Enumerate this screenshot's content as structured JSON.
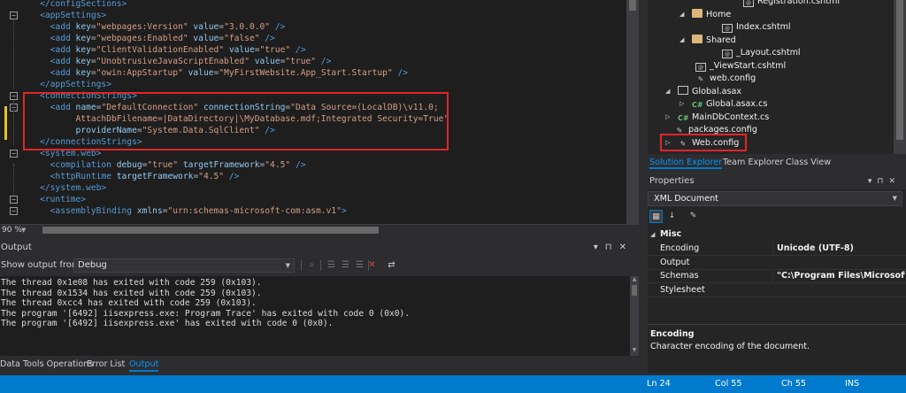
{
  "editor": {
    "lines": [
      [
        {
          "t": "tag",
          "s": "    </configSections>"
        }
      ],
      [
        {
          "t": "tag",
          "s": "    <appSettings>"
        }
      ],
      [
        {
          "t": "tag",
          "s": "      <add "
        },
        {
          "t": "attr",
          "s": "key"
        },
        {
          "t": "plain",
          "s": "="
        },
        {
          "t": "val",
          "s": "\"webpages:Version\""
        },
        {
          "t": "attr",
          "s": " value"
        },
        {
          "t": "plain",
          "s": "="
        },
        {
          "t": "val",
          "s": "\"3.0.0.0\""
        },
        {
          "t": "tag",
          "s": " />"
        }
      ],
      [
        {
          "t": "tag",
          "s": "      <add "
        },
        {
          "t": "attr",
          "s": "key"
        },
        {
          "t": "plain",
          "s": "="
        },
        {
          "t": "val",
          "s": "\"webpages:Enabled\""
        },
        {
          "t": "attr",
          "s": " value"
        },
        {
          "t": "plain",
          "s": "="
        },
        {
          "t": "val",
          "s": "\"false\""
        },
        {
          "t": "tag",
          "s": " />"
        }
      ],
      [
        {
          "t": "tag",
          "s": "      <add "
        },
        {
          "t": "attr",
          "s": "key"
        },
        {
          "t": "plain",
          "s": "="
        },
        {
          "t": "val",
          "s": "\"ClientValidationEnabled\""
        },
        {
          "t": "attr",
          "s": " value"
        },
        {
          "t": "plain",
          "s": "="
        },
        {
          "t": "val",
          "s": "\"true\""
        },
        {
          "t": "tag",
          "s": " />"
        }
      ],
      [
        {
          "t": "tag",
          "s": "      <add "
        },
        {
          "t": "attr",
          "s": "key"
        },
        {
          "t": "plain",
          "s": "="
        },
        {
          "t": "val",
          "s": "\"UnobtrusiveJavaScriptEnabled\""
        },
        {
          "t": "attr",
          "s": " value"
        },
        {
          "t": "plain",
          "s": "="
        },
        {
          "t": "val",
          "s": "\"true\""
        },
        {
          "t": "tag",
          "s": " />"
        }
      ],
      [
        {
          "t": "tag",
          "s": "      <add "
        },
        {
          "t": "attr",
          "s": "key"
        },
        {
          "t": "plain",
          "s": "="
        },
        {
          "t": "val",
          "s": "\"owin:AppStartup\""
        },
        {
          "t": "attr",
          "s": " value"
        },
        {
          "t": "plain",
          "s": "="
        },
        {
          "t": "val",
          "s": "\"MyFirstWebsite.App_Start.Startup\""
        },
        {
          "t": "tag",
          "s": " />"
        }
      ],
      [
        {
          "t": "tag",
          "s": "    </appSettings>"
        }
      ],
      [
        {
          "t": "tag",
          "s": "    <connectionStrings>"
        }
      ],
      [
        {
          "t": "tag",
          "s": "      <add "
        },
        {
          "t": "attr",
          "s": "name"
        },
        {
          "t": "plain",
          "s": "="
        },
        {
          "t": "val",
          "s": "\"DefaultConnection\""
        },
        {
          "t": "attr",
          "s": " connectionString"
        },
        {
          "t": "plain",
          "s": "="
        },
        {
          "t": "val",
          "s": "\"Data Source=(LocalDB)\\v11.0;"
        }
      ],
      [
        {
          "t": "val",
          "s": "           AttachDbFilename=|DataDirectory|\\MyDatabase.mdf;Integrated Security=True\""
        }
      ],
      [
        {
          "t": "attr",
          "s": "           providerName"
        },
        {
          "t": "plain",
          "s": "="
        },
        {
          "t": "val",
          "s": "\"System.Data.SqlClient\""
        },
        {
          "t": "tag",
          "s": " />"
        }
      ],
      [
        {
          "t": "tag",
          "s": "    </connectionStrings>"
        }
      ],
      [
        {
          "t": "tag",
          "s": "    <system.web>"
        }
      ],
      [
        {
          "t": "tag",
          "s": "      <compilation "
        },
        {
          "t": "attr",
          "s": "debug"
        },
        {
          "t": "plain",
          "s": "="
        },
        {
          "t": "val",
          "s": "\"true\""
        },
        {
          "t": "attr",
          "s": " targetFramework"
        },
        {
          "t": "plain",
          "s": "="
        },
        {
          "t": "val",
          "s": "\"4.5\""
        },
        {
          "t": "tag",
          "s": " />"
        }
      ],
      [
        {
          "t": "tag",
          "s": "      <httpRuntime "
        },
        {
          "t": "attr",
          "s": "targetFramework"
        },
        {
          "t": "plain",
          "s": "="
        },
        {
          "t": "val",
          "s": "\"4.5\""
        },
        {
          "t": "tag",
          "s": " />"
        }
      ],
      [
        {
          "t": "tag",
          "s": "    </system.web>"
        }
      ],
      [
        {
          "t": "tag",
          "s": "    <runtime>"
        }
      ],
      [
        {
          "t": "tag",
          "s": "      <assemblyBinding "
        },
        {
          "t": "attr",
          "s": "xmlns"
        },
        {
          "t": "plain",
          "s": "="
        },
        {
          "t": "val",
          "s": "\"urn:schemas-microsoft-com:asm.v1\""
        },
        {
          "t": "tag",
          "s": ">"
        }
      ]
    ],
    "zoom": "90 %"
  },
  "output": {
    "title": "Output",
    "show_from_label": "Show output from:",
    "source": "Debug",
    "lines": [
      "The thread 0x1e08 has exited with code 259 (0x103).",
      "The thread 0x1534 has exited with code 259 (0x103).",
      "The thread 0xcc4 has exited with code 259 (0x103).",
      "The program '[6492] iisexpress.exe: Program Trace' has exited with code 0 (0x0).",
      "The program '[6492] iisexpress.exe' has exited with code 0 (0x0)."
    ]
  },
  "bottom_tabs": [
    "Data Tools Operations",
    "Error List",
    "Output"
  ],
  "solution_explorer": {
    "items": [
      {
        "label": "Registration.cshtml",
        "icon": "cshtml-file-icon"
      },
      {
        "label": "Home",
        "icon": "folder-icon"
      },
      {
        "label": "Index.cshtml",
        "icon": "cshtml-file-icon"
      },
      {
        "label": "Shared",
        "icon": "folder-icon"
      },
      {
        "label": "_Layout.cshtml",
        "icon": "cshtml-file-icon"
      },
      {
        "label": "_ViewStart.cshtml",
        "icon": "cshtml-file-icon"
      },
      {
        "label": "web.config",
        "icon": "config-file-icon"
      },
      {
        "label": "Global.asax",
        "icon": "asax-file-icon"
      },
      {
        "label": "Global.asax.cs",
        "icon": "cs-file-icon"
      },
      {
        "label": "MainDbContext.cs",
        "icon": "cs-file-icon"
      },
      {
        "label": "packages.config",
        "icon": "config-file-icon"
      },
      {
        "label": "Web.config",
        "icon": "config-file-icon"
      }
    ],
    "tabs": [
      "Solution Explorer",
      "Team Explorer",
      "Class View"
    ]
  },
  "properties": {
    "title": "Properties",
    "object": "XML Document",
    "category": "Misc",
    "rows": [
      {
        "name": "Encoding",
        "value": "Unicode (UTF-8)"
      },
      {
        "name": "Output",
        "value": ""
      },
      {
        "name": "Schemas",
        "value": "\"C:\\Program Files\\Microsoft Vis"
      },
      {
        "name": "Stylesheet",
        "value": ""
      }
    ],
    "desc_title": "Encoding",
    "desc_text": "Character encoding of the document."
  },
  "status": {
    "ln": "Ln 24",
    "col": "Col 55",
    "ch": "Ch 55",
    "mode": "INS"
  },
  "colors": {
    "accent": "#007acc",
    "highlight_box": "#e0262a"
  }
}
